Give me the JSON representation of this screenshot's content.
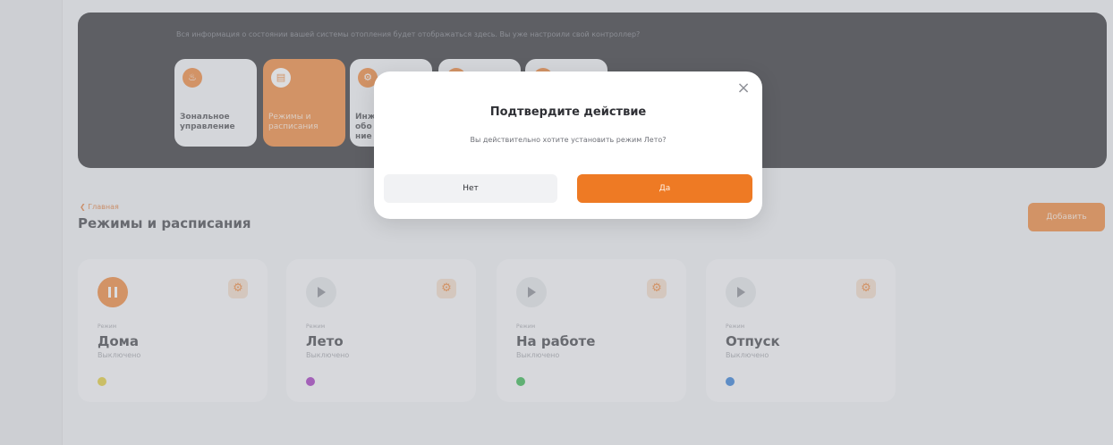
{
  "banner": {
    "text": "Вся информация о состоянии вашей системы отопления будет отображаться здесь. Вы уже настроили свой контроллер?",
    "tiles": [
      {
        "label": "Зональное\nуправление",
        "icon": "thermometer-icon",
        "active": false
      },
      {
        "label": "Режимы и\nрасписания",
        "icon": "calendar-icon",
        "active": true
      },
      {
        "label": "Инж\nобо\nние",
        "icon": "gear-icon",
        "active": false
      },
      {
        "label": "",
        "icon": "tile-icon",
        "active": false
      },
      {
        "label": "",
        "icon": "tile-icon",
        "active": false
      }
    ]
  },
  "header": {
    "back_label": "Главная",
    "title": "Режимы и расписания",
    "add_label": "Добавить"
  },
  "modes": [
    {
      "sub": "Режим",
      "name": "Дома",
      "status": "Выключено",
      "dot_color": "#e0c823",
      "state": "pause"
    },
    {
      "sub": "Режим",
      "name": "Лето",
      "status": "Выключено",
      "dot_color": "#9a1fb8",
      "state": "play"
    },
    {
      "sub": "Режим",
      "name": "На работе",
      "status": "Выключено",
      "dot_color": "#1fb03c",
      "state": "play"
    },
    {
      "sub": "Режим",
      "name": "Отпуск",
      "status": "Выключено",
      "dot_color": "#1c6fd2",
      "state": "play"
    }
  ],
  "modal": {
    "title": "Подтвердите действие",
    "text": "Вы действительно хотите установить режим Лето?",
    "no_label": "Нет",
    "yes_label": "Да",
    "close_glyph": "×"
  },
  "colors": {
    "accent": "#ee7a24",
    "banner_bg": "#1c1d20"
  }
}
